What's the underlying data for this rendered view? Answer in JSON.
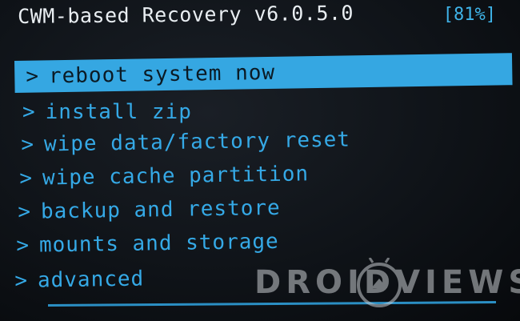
{
  "header": {
    "title": "CWM-based Recovery v6.0.5.0",
    "battery": "[81%]"
  },
  "menu": {
    "arrow": ">",
    "items": [
      {
        "label": "reboot system now",
        "selected": true
      },
      {
        "label": "install zip",
        "selected": false
      },
      {
        "label": "wipe data/factory reset",
        "selected": false
      },
      {
        "label": "wipe cache partition",
        "selected": false
      },
      {
        "label": "backup and restore",
        "selected": false
      },
      {
        "label": "mounts and storage",
        "selected": false
      },
      {
        "label": "advanced",
        "selected": false
      }
    ]
  },
  "watermark": {
    "text": "DROIDVIEWS",
    "logo_icon": "android-logo-icon"
  },
  "colors": {
    "accent": "#35a7e2",
    "title_text": "#e9eef2",
    "background": "#0b0e12"
  }
}
